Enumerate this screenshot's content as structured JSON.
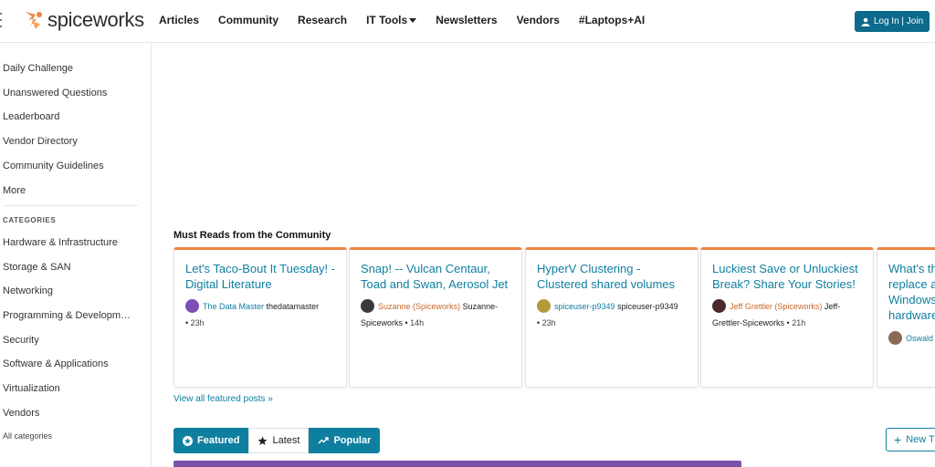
{
  "brand": {
    "name": "spiceworks"
  },
  "nav": [
    {
      "label": "Articles"
    },
    {
      "label": "Community"
    },
    {
      "label": "Research"
    },
    {
      "label": "IT Tools",
      "dropdown": true
    },
    {
      "label": "Newsletters"
    },
    {
      "label": "Vendors"
    },
    {
      "label": "#Laptops+AI"
    }
  ],
  "login": {
    "label": "Log In | Join"
  },
  "sidebar": {
    "links": [
      "Daily Challenge",
      "Unanswered Questions",
      "Leaderboard",
      "Vendor Directory",
      "Community Guidelines",
      "More"
    ],
    "categories_heading": "CATEGORIES",
    "categories": [
      "Hardware & Infrastructure",
      "Storage & SAN",
      "Networking",
      "Programming & Developm…",
      "Security",
      "Software & Applications",
      "Virtualization",
      "Vendors"
    ],
    "all_categories": "All categories"
  },
  "must_reads": {
    "title": "Must Reads from the Community",
    "view_all": "View all featured posts »",
    "cards": [
      {
        "title": "Let's Taco-Bout It Tuesday! - Digital Literature",
        "author": "The Data Master",
        "username": "thedatamaster",
        "time": "23h",
        "avatar_color": "#7b4fb5",
        "author_color": "blue"
      },
      {
        "title": "Snap! -- Vulcan Centaur, Toad and Swan, Aerosol Jet",
        "author": "Suzanne (Spiceworks)",
        "username": "Suzanne-Spiceworks",
        "time": "14h",
        "avatar_color": "#3a3a3a",
        "author_color": "orange"
      },
      {
        "title": "HyperV Clustering - Clustered shared volumes",
        "author": "spiceuser-p9349",
        "username": "spiceuser-p9349",
        "time": "23h",
        "avatar_color": "#b59a3c",
        "author_color": "blue"
      },
      {
        "title": "Luckiest Save or Unluckiest Break? Share Your Stories!",
        "author": "Jeff Grettler (Spiceworks)",
        "username": "Jeff-Grettler-Spiceworks",
        "time": "21h",
        "avatar_color": "#4a2a2a",
        "author_color": "orange"
      },
      {
        "title": "What's th replace a Windows hardware",
        "author": "Oswald",
        "username": "",
        "time": "",
        "avatar_color": "#8a6a55",
        "author_color": "blue"
      }
    ]
  },
  "tabs": [
    {
      "label": "Featured",
      "icon": "star-circle-icon",
      "active": true
    },
    {
      "label": "Latest",
      "icon": "star-icon",
      "active": false
    },
    {
      "label": "Popular",
      "icon": "trend-icon",
      "active": true
    }
  ],
  "new_topic": {
    "label": "New T"
  },
  "colors": {
    "accent": "#0f7fa0",
    "card_border_top": "#f08443",
    "login_bg": "#0c6a8a",
    "banner": "#7a52a8"
  }
}
